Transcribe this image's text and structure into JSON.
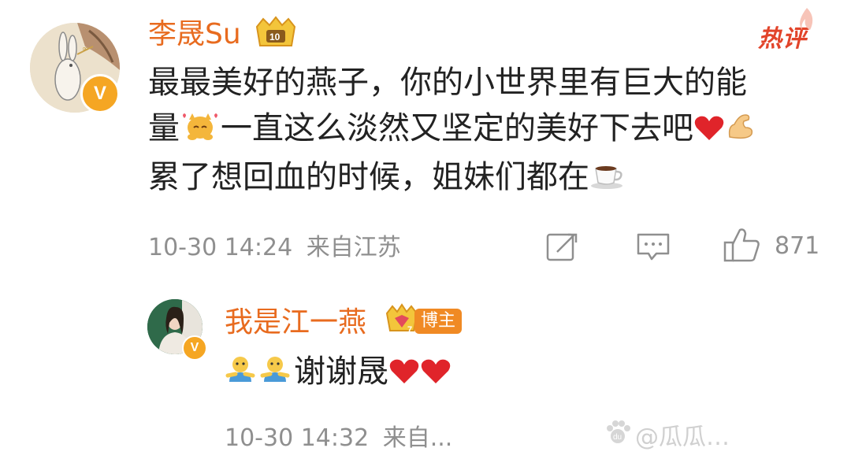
{
  "comment": {
    "username": "李晟Su",
    "hot_tag": "热评",
    "lines": [
      "最最美好的燕子，你的小世界里有巨大的能",
      "量",
      "一直这么淡然又坚定的美好下去吧",
      "累了想回血的时候，姐妹们都在"
    ],
    "timestamp": "10-30 14:24",
    "location": "来自江苏",
    "like_count": "871",
    "verified_badge": "V"
  },
  "reply": {
    "username": "我是江一燕",
    "role_badge": "博主",
    "text": "谢谢晟",
    "timestamp": "10-30 14:32",
    "location": "来自...",
    "verified_badge": "V"
  },
  "watermark": {
    "text": "@瓜瓜…"
  },
  "icons": {
    "member_badge": "vip-crown-icon",
    "share": "share-icon",
    "comment": "comment-icon",
    "like": "thumbs-up-icon"
  },
  "colors": {
    "username": "#e86b1f",
    "verified": "#f5a623",
    "hot": "#e2442a",
    "meta": "#8f8f8f"
  }
}
